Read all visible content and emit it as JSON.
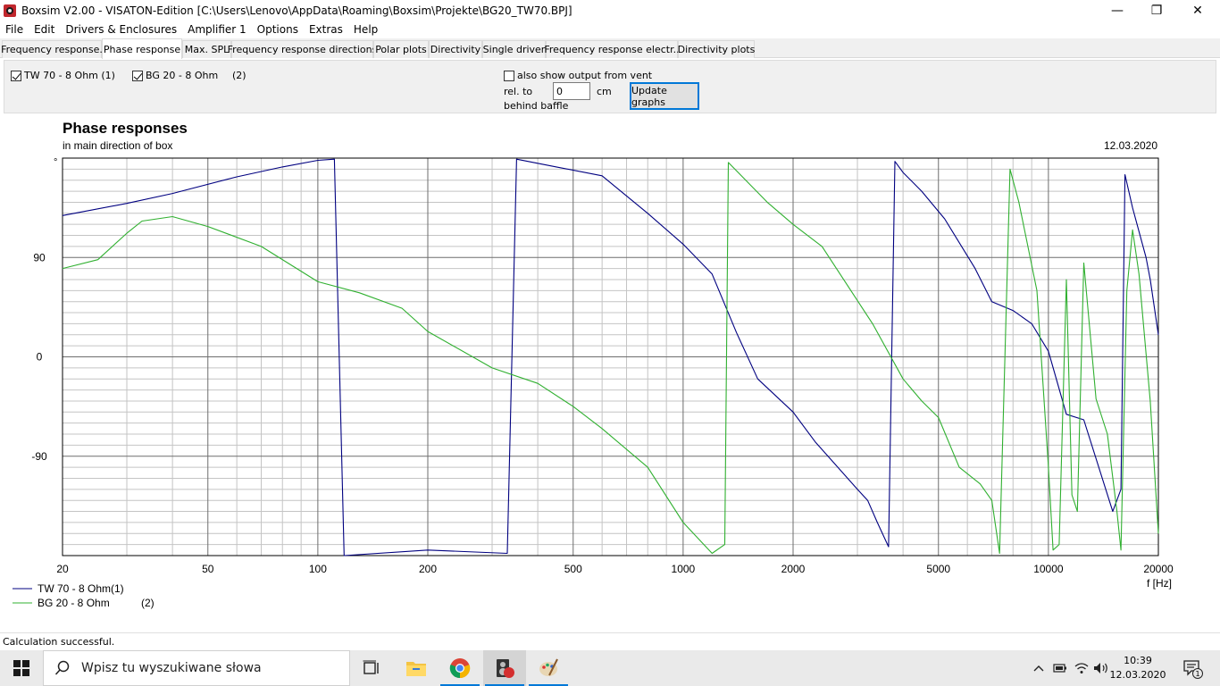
{
  "window": {
    "title": "Boxsim V2.00 - VISATON-Edition [C:\\Users\\Lenovo\\AppData\\Roaming\\Boxsim\\Projekte\\BG20_TW70.BPJ]",
    "minimize": "—",
    "maximize": "❐",
    "close": "✕"
  },
  "menu": [
    "File",
    "Edit",
    "Drivers & Enclosures",
    "Amplifier 1",
    "Options",
    "Extras",
    "Help"
  ],
  "tabs": [
    {
      "label": "Frequency response.",
      "active": false
    },
    {
      "label": "Phase response",
      "active": true
    },
    {
      "label": "Max. SPL",
      "active": false
    },
    {
      "label": "Frequency response directions",
      "active": false
    },
    {
      "label": "Polar plots",
      "active": false
    },
    {
      "label": "Directivity",
      "active": false
    },
    {
      "label": "Single driver",
      "active": false
    },
    {
      "label": "Frequency response electr..",
      "active": false
    },
    {
      "label": "Directivity plots",
      "active": false
    }
  ],
  "controls": {
    "driver1": {
      "label": "TW 70 - 8 Ohm (1)",
      "checked": true
    },
    "driver2": {
      "label": "BG 20 - 8 Ohm",
      "index": "(2)",
      "checked": true
    },
    "vent": {
      "label": "also show output from vent",
      "checked": false
    },
    "rel_to": "rel. to",
    "behind_baffle": "behind baffle",
    "offset_value": "0",
    "unit": "cm",
    "update_button": "Update graphs"
  },
  "chart_data": {
    "type": "line",
    "title": "Phase responses",
    "subtitle": "in main direction of box",
    "date": "12.03.2020",
    "xlabel": "f [Hz]",
    "ylabel": "°",
    "x_scale": "log",
    "xlim": [
      20,
      20000
    ],
    "ylim": [
      -180,
      180
    ],
    "x_ticks": [
      20,
      50,
      100,
      200,
      500,
      1000,
      2000,
      5000,
      10000,
      20000
    ],
    "x_tick_labels": [
      "20",
      "50",
      "100",
      "200",
      "500",
      "1000",
      "2000",
      "5000",
      "10000",
      "20000"
    ],
    "y_ticks": [
      -90,
      0,
      90
    ],
    "y_tick_labels": [
      "-90",
      "0",
      "90"
    ],
    "grid": true,
    "legend_position": "bottom-left",
    "series": [
      {
        "name": "TW 70 - 8 Ohm(1)",
        "color": "#000080",
        "points": [
          [
            20,
            128
          ],
          [
            30,
            139
          ],
          [
            40,
            148
          ],
          [
            60,
            163
          ],
          [
            80,
            172
          ],
          [
            100,
            178
          ],
          [
            111,
            179
          ],
          [
            118,
            -180
          ],
          [
            200,
            -175
          ],
          [
            330,
            -178
          ],
          [
            350,
            179
          ],
          [
            450,
            172
          ],
          [
            600,
            164
          ],
          [
            800,
            130
          ],
          [
            1000,
            102
          ],
          [
            1200,
            75
          ],
          [
            1400,
            22
          ],
          [
            1600,
            -20
          ],
          [
            2000,
            -50
          ],
          [
            2300,
            -77
          ],
          [
            3000,
            -120
          ],
          [
            3200,
            -130
          ],
          [
            3400,
            -150
          ],
          [
            3650,
            -172
          ],
          [
            3800,
            177
          ],
          [
            4000,
            167
          ],
          [
            4500,
            150
          ],
          [
            5200,
            125
          ],
          [
            6300,
            80
          ],
          [
            7000,
            50
          ],
          [
            8000,
            42
          ],
          [
            9000,
            30
          ],
          [
            10000,
            5
          ],
          [
            11200,
            -52
          ],
          [
            12500,
            -57
          ],
          [
            15000,
            -140
          ],
          [
            15800,
            -120
          ],
          [
            16200,
            165
          ],
          [
            17000,
            135
          ],
          [
            18500,
            90
          ],
          [
            19000,
            70
          ],
          [
            20000,
            20
          ]
        ]
      },
      {
        "name": "BG 20 - 8 Ohm",
        "label_suffix": "(2)",
        "color": "#30b030",
        "points": [
          [
            20,
            80
          ],
          [
            25,
            88
          ],
          [
            30,
            112
          ],
          [
            33,
            123
          ],
          [
            40,
            127
          ],
          [
            50,
            118
          ],
          [
            70,
            100
          ],
          [
            100,
            68
          ],
          [
            130,
            58
          ],
          [
            170,
            44
          ],
          [
            200,
            23
          ],
          [
            300,
            -10
          ],
          [
            400,
            -24
          ],
          [
            500,
            -45
          ],
          [
            600,
            -65
          ],
          [
            800,
            -100
          ],
          [
            1000,
            -150
          ],
          [
            1200,
            -178
          ],
          [
            1300,
            -170
          ],
          [
            1330,
            176
          ],
          [
            1700,
            140
          ],
          [
            2000,
            120
          ],
          [
            2400,
            100
          ],
          [
            3300,
            30
          ],
          [
            4000,
            -20
          ],
          [
            4500,
            -40
          ],
          [
            5000,
            -55
          ],
          [
            5700,
            -100
          ],
          [
            6500,
            -115
          ],
          [
            7000,
            -130
          ],
          [
            7350,
            -178
          ],
          [
            7850,
            170
          ],
          [
            8300,
            140
          ],
          [
            9300,
            60
          ],
          [
            10000,
            -100
          ],
          [
            10300,
            -175
          ],
          [
            10700,
            -170
          ],
          [
            11200,
            70
          ],
          [
            11600,
            -125
          ],
          [
            12000,
            -140
          ],
          [
            12500,
            85
          ],
          [
            13500,
            -38
          ],
          [
            14500,
            -70
          ],
          [
            15400,
            -140
          ],
          [
            15800,
            -175
          ],
          [
            16400,
            60
          ],
          [
            17000,
            115
          ],
          [
            17700,
            75
          ],
          [
            19000,
            -40
          ],
          [
            20000,
            -160
          ]
        ]
      }
    ]
  },
  "status": "Calculation successful.",
  "taskbar": {
    "search_placeholder": "Wpisz tu wyszukiwane słowa",
    "time": "10:39",
    "date": "12.03.2020",
    "notification_count": "1"
  }
}
